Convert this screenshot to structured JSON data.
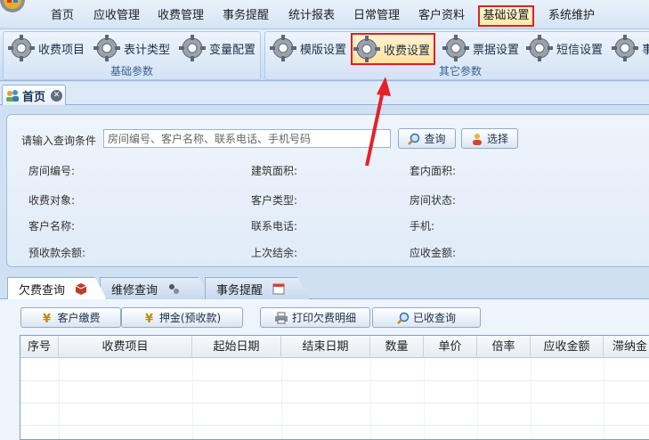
{
  "menu": {
    "items": [
      "首页",
      "应收管理",
      "收费管理",
      "事务提醒",
      "统计报表",
      "日常管理",
      "客户资料",
      "基础设置",
      "系统维护"
    ],
    "active": "基础设置"
  },
  "ribbon": {
    "group1": {
      "label": "基础参数",
      "buttons": [
        "收费项目",
        "表计类型",
        "变量配置"
      ]
    },
    "group2": {
      "label": "其它参数",
      "buttons": [
        "模版设置",
        "收费设置",
        "票据设置",
        "短信设置",
        "事"
      ]
    }
  },
  "page_tab": {
    "label": "首页"
  },
  "query": {
    "label": "请输入查询条件",
    "placeholder": "房间编号、客户名称、联系电话、手机号码",
    "search_btn": "查询",
    "select_btn": "选择"
  },
  "fields": {
    "room_no": "房间编号:",
    "build_area": "建筑面积:",
    "inner_area": "套内面积:",
    "charge_target": "收费对象:",
    "customer_type": "客户类型:",
    "room_status": "房间状态:",
    "customer_name": "客户名称:",
    "phone": "联系电话:",
    "mobile": "手机:",
    "prepaid_balance": "预收款余额:",
    "last_settle": "上次结余:",
    "receivable": "应收金额:"
  },
  "bottom_tabs": [
    "欠费查询",
    "维修查询",
    "事务提醒"
  ],
  "actions": [
    "客户缴费",
    "押金(预收款)",
    "打印欠费明细",
    "已收查询"
  ],
  "table": {
    "columns": [
      "序号",
      "收费项目",
      "起始日期",
      "结束日期",
      "数量",
      "单价",
      "倍率",
      "应收金额",
      "滞纳金"
    ]
  }
}
